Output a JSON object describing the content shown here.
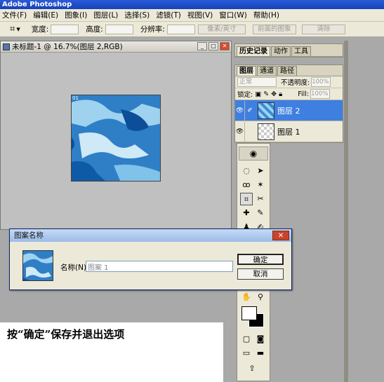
{
  "app": {
    "title": "Adobe Photoshop"
  },
  "menu": [
    "文件(F)",
    "编辑(E)",
    "图象(I)",
    "图层(L)",
    "选择(S)",
    "滤镜(T)",
    "视图(V)",
    "窗口(W)",
    "帮助(H)"
  ],
  "options": {
    "tool_icon": "crop-icon",
    "width_label": "宽度:",
    "height_label": "高度:",
    "resolution_label": "分辨率:",
    "unit_value": "像素/英寸",
    "front_image_label": "前面的图象",
    "clear_label": "清除"
  },
  "document": {
    "title": "未标题-1 @ 16.7%(图层 2,RGB)",
    "thumb_label": "01"
  },
  "panel_top": {
    "tabs": [
      "历史记录",
      "动作",
      "工具"
    ]
  },
  "layers": {
    "tabs": [
      "图层",
      "通道",
      "路径"
    ],
    "blend_mode": "正常",
    "opacity_label": "不透明度:",
    "opacity_value": "100%",
    "lock_label": "锁定:",
    "fill_label": "Fill:",
    "fill_value": "100%",
    "items": [
      {
        "name": "图层 2",
        "selected": true
      },
      {
        "name": "图层 1",
        "selected": false
      }
    ]
  },
  "dialog": {
    "title": "图案名称",
    "name_label": "名称(N):",
    "name_value": "图案 1",
    "ok_label": "确定",
    "cancel_label": "取消"
  },
  "caption": "按“确定”保存并退出选项"
}
